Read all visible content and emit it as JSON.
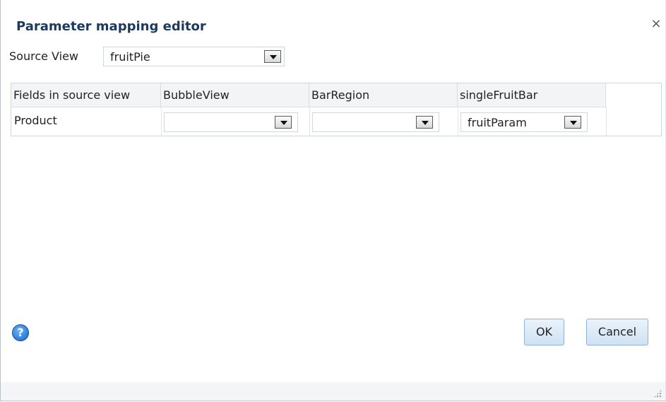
{
  "dialog": {
    "title": "Parameter mapping editor",
    "close_glyph": "×"
  },
  "source": {
    "label": "Source View",
    "value": "fruitPie"
  },
  "table": {
    "headers": [
      "Fields in source view",
      "BubbleView",
      "BarRegion",
      "singleFruitBar"
    ],
    "rows": [
      {
        "field": "Product",
        "mappings": [
          "",
          "",
          "fruitParam"
        ]
      }
    ]
  },
  "footer": {
    "help_glyph": "?",
    "ok_label": "OK",
    "cancel_label": "Cancel"
  },
  "colors": {
    "title": "#1c3a5e",
    "button_border": "#8fb3d4",
    "header_bg": "#f3f4f5"
  }
}
